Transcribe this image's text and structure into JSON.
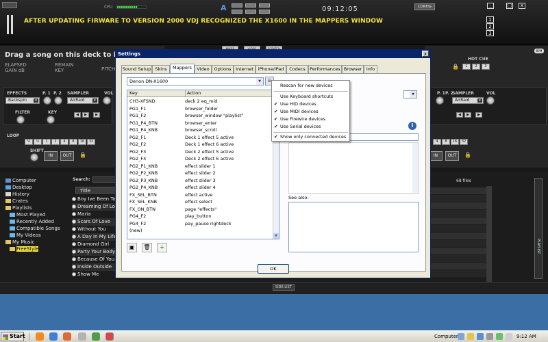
{
  "app": {
    "cpu_label": "CPU",
    "cpu_level": 0.72,
    "clock": "09:12:05",
    "config_label": "CONFIG",
    "banner": "AFTER UPDATING FIRWARE TO VERSION 2000 VDJ RECOGNIZED THE X1600 IN THE MAPPERS WINDOW",
    "win_controls": [
      "_",
      "□",
      "x"
    ],
    "layout_numbers": [
      "1",
      "2",
      "3"
    ],
    "center_mark": "A",
    "deck_tabs": [
      "MIXER",
      "VIDEO",
      "SCRATCH"
    ]
  },
  "left_deck": {
    "drag_text": "Drag a song on this deck to load it",
    "elapsed": "ELAPSED",
    "gain": "GAIN dB",
    "remain": "REMAIN",
    "key": "KEY",
    "pitch": "PITCH",
    "effects_label": "EFFECTS",
    "effect_value": "Backspin",
    "sampler_label": "SAMPLER",
    "sampler_value": "AirRaid",
    "filter_label": "FILTER",
    "key_label": "KEY",
    "loop_label": "LOOP",
    "shift_label": "SHIFT",
    "in_label": "IN",
    "out_label": "OUT",
    "loop_values": [
      "¼",
      "½",
      "1",
      "2",
      "4",
      "8",
      "16",
      "32"
    ],
    "p1": "P. 1",
    "p2": "P. 2",
    "vol": "VOL"
  },
  "right_deck": {
    "bpm": "BPM",
    "hot_cue": "HOT CUE",
    "sampler_label": "SAMPLER",
    "sampler_value": "AirRaid",
    "vol": "VOL",
    "p1": "P. 1",
    "p2": "P. 2",
    "in_label": "IN",
    "out_label": "OUT",
    "loop_values": [
      "4",
      "8",
      "16",
      "32"
    ]
  },
  "browser": {
    "tree": [
      {
        "label": "Computer",
        "icon": "computer-icon"
      },
      {
        "label": "Desktop",
        "icon": "desktop-icon"
      },
      {
        "label": "History",
        "icon": "history-icon"
      },
      {
        "label": "Crates",
        "icon": "crates-icon"
      },
      {
        "label": "Playlists",
        "icon": "playlists-icon"
      },
      {
        "label": "Most Played",
        "icon": "folder-icon"
      },
      {
        "label": "Recently Added",
        "icon": "folder-icon"
      },
      {
        "label": "Compatible Songs",
        "icon": "folder-icon"
      },
      {
        "label": "My Videos",
        "icon": "folder-icon"
      },
      {
        "label": "My Music",
        "icon": "folder-icon"
      },
      {
        "label": "FreeStyle",
        "icon": "folder-icon"
      }
    ],
    "search_label": "Search:",
    "title_header": "Title",
    "songs": [
      "Boy Ive Been To",
      "Dreaming Of Lo",
      "Maria",
      "Scars Of Love",
      "Without You",
      "A Day In My Life",
      "Diamond Girl",
      "Party Your Body",
      "Because Of You",
      "Inside Outside",
      "Show Me"
    ],
    "files_count": "68 files",
    "side_list": "SIDE LIST",
    "playlist_tab": "PLAYLIST"
  },
  "settings": {
    "title": "Settings",
    "close": "x",
    "tabs": [
      "Sound Setup",
      "Skins",
      "Mappers",
      "Video",
      "Options",
      "Internet",
      "iPhone/iPad",
      "Codecs",
      "Performances",
      "Browser",
      "Info"
    ],
    "active_tab": "Mappers",
    "device": "Denon DN-X1600",
    "columns": {
      "key": "Key",
      "action": "Action"
    },
    "mappings": [
      {
        "key": "CH3-XFSND",
        "action": "deck 2 eq_mid"
      },
      {
        "key": "PG1_F1",
        "action": "browser_folder"
      },
      {
        "key": "PG1_F2",
        "action": "browser_window \"playlist\""
      },
      {
        "key": "PG1_P4_BTN",
        "action": "browser_enter"
      },
      {
        "key": "PG1_P4_KNB",
        "action": "browser_scroll"
      },
      {
        "key": "PG2_F1",
        "action": "Deck 1 effect 5 active"
      },
      {
        "key": "PG2_F2",
        "action": "Deck 1 effect 6 active"
      },
      {
        "key": "PG2_F3",
        "action": "Deck 2 effect 5 active"
      },
      {
        "key": "PG2_F4",
        "action": "Deck 2 effect 6 active"
      },
      {
        "key": "PG2_P1_KNB",
        "action": "effect slider 1"
      },
      {
        "key": "PG2_P2_KNB",
        "action": "effect slider 2"
      },
      {
        "key": "PG2_P3_KNB",
        "action": "effect slider 3"
      },
      {
        "key": "PG2_P4_KNB",
        "action": "effect slider 4"
      },
      {
        "key": "FX_SEL_BTN",
        "action": "effect active"
      },
      {
        "key": "FX_SEL_KNB",
        "action": "effect select"
      },
      {
        "key": "FX_ON_BTN",
        "action": "page \"effects\""
      },
      {
        "key": "PG4_F2",
        "action": "play_button"
      },
      {
        "key": "PG4_F2",
        "action": "pay_pause rightdeck"
      },
      {
        "key": "(new)",
        "action": ""
      }
    ],
    "see_also": "See also:",
    "ok": "OK",
    "context_menu": [
      {
        "label": "Rescan for new devices",
        "checked": false
      },
      {
        "label": "Use Keyboard shortcuts",
        "checked": false
      },
      {
        "label": "Use HID devices",
        "checked": true
      },
      {
        "label": "Use MIDI devices",
        "checked": true
      },
      {
        "label": "Use Firewire devices",
        "checked": true
      },
      {
        "label": "Use Serial devices",
        "checked": true
      },
      {
        "label": "Show only connected devices",
        "checked": true
      }
    ]
  },
  "taskbar": {
    "start": "Start",
    "tray_label": "Computer",
    "time": "9:12 AM"
  }
}
